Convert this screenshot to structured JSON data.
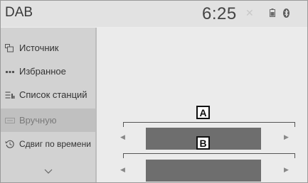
{
  "header": {
    "title": "DAB",
    "clock": "6:25"
  },
  "sidebar": {
    "items": [
      {
        "label": "Источник",
        "icon": "source-icon"
      },
      {
        "label": "Избранное",
        "icon": "favorites-icon"
      },
      {
        "label": "Список станций",
        "icon": "station-list-icon"
      },
      {
        "label": "Вручную",
        "icon": "manual-icon",
        "active": true
      },
      {
        "label": "Сдвиг по времени",
        "icon": "time-shift-icon"
      }
    ],
    "more_icon": "chevron-down-icon"
  },
  "main": {
    "callouts": [
      {
        "letter": "A"
      },
      {
        "letter": "B"
      }
    ]
  },
  "colors": {
    "bar": "#6e6e6e",
    "sidebar": "#d2d2d2",
    "active_item": "#c0c0c0"
  }
}
